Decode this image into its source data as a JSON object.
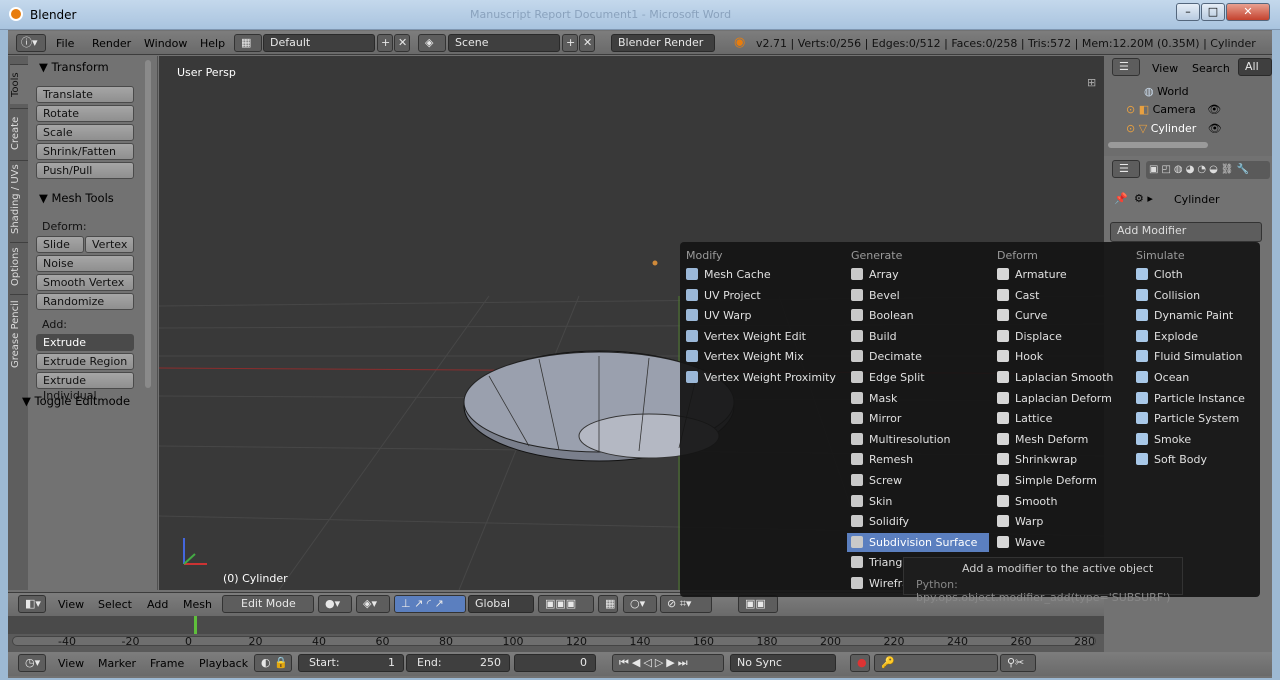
{
  "window": {
    "title": "Blender",
    "ghost_title": "Manuscript Report Document1 - Microsoft Word",
    "min": "–",
    "max": "□",
    "close": "✕"
  },
  "topbar": {
    "menus": [
      "File",
      "Render",
      "Window",
      "Help"
    ],
    "layout": "Default",
    "scene": "Scene",
    "engine": "Blender Render",
    "stats": "v2.71 | Verts:0/256 | Edges:0/512 | Faces:0/258 | Tris:572 | Mem:12.20M (0.35M) | Cylinder"
  },
  "tabs": [
    "Tools",
    "Create",
    "Shading / UVs",
    "Options",
    "Grease Pencil"
  ],
  "transform": {
    "header": "▼ Transform",
    "buttons": [
      "Translate",
      "Rotate",
      "Scale",
      "Shrink/Fatten",
      "Push/Pull"
    ]
  },
  "meshtools": {
    "header": "▼ Mesh Tools",
    "deform_label": "Deform:",
    "slide": "Slide Ed",
    "vertex": "Vertex",
    "buttons": [
      "Noise",
      "Smooth Vertex",
      "Randomize"
    ],
    "add_label": "Add:",
    "extrude": "Extrude",
    "extrude_btns": [
      "Extrude Region",
      "Extrude Individual"
    ]
  },
  "toggle": "▼ Toggle Editmode",
  "viewport": {
    "label": "User Persp",
    "object": "(0) Cylinder"
  },
  "outliner": {
    "tabs": [
      "View",
      "Search",
      "All Sc"
    ],
    "items": [
      "World",
      "Camera",
      "Cylinder"
    ]
  },
  "props": {
    "object": "Cylinder",
    "add_modifier": "Add Modifier"
  },
  "menu": {
    "columns": [
      {
        "header": "Modify",
        "items": [
          "Mesh Cache",
          "UV Project",
          "UV Warp",
          "Vertex Weight Edit",
          "Vertex Weight Mix",
          "Vertex Weight Proximity"
        ]
      },
      {
        "header": "Generate",
        "items": [
          "Array",
          "Bevel",
          "Boolean",
          "Build",
          "Decimate",
          "Edge Split",
          "Mask",
          "Mirror",
          "Multiresolution",
          "Remesh",
          "Screw",
          "Skin",
          "Solidify",
          "Subdivision Surface",
          "Triangulate",
          "Wireframe"
        ]
      },
      {
        "header": "Deform",
        "items": [
          "Armature",
          "Cast",
          "Curve",
          "Displace",
          "Hook",
          "Laplacian Smooth",
          "Laplacian Deform",
          "Lattice",
          "Mesh Deform",
          "Shrinkwrap",
          "Simple Deform",
          "Smooth",
          "Warp",
          "Wave"
        ]
      },
      {
        "header": "Simulate",
        "items": [
          "Cloth",
          "Collision",
          "Dynamic Paint",
          "Explode",
          "Fluid Simulation",
          "Ocean",
          "Particle Instance",
          "Particle System",
          "Smoke",
          "Soft Body"
        ]
      }
    ],
    "highlighted": "Subdivision Surface",
    "tooltip_line1": "Add a modifier to the active object",
    "tooltip_line2": "Python: bpy.ops.object.modifier_add(type='SUBSURF')"
  },
  "viewheader": {
    "menus": [
      "View",
      "Select",
      "Add",
      "Mesh"
    ],
    "mode": "Edit Mode",
    "orientation": "Global"
  },
  "timeline": {
    "ticks": [
      "-40",
      "-20",
      "0",
      "20",
      "40",
      "60",
      "80",
      "100",
      "120",
      "140",
      "160",
      "180",
      "200",
      "220",
      "240",
      "260",
      "280"
    ]
  },
  "tlheader": {
    "menus": [
      "View",
      "Marker",
      "Frame",
      "Playback"
    ],
    "start_label": "Start:",
    "start": "1",
    "end_label": "End:",
    "end": "250",
    "current": "0",
    "sync": "No Sync"
  },
  "colors": {
    "highlight": "#5b7fbf",
    "viewport": "#393939",
    "panel": "#727272"
  }
}
